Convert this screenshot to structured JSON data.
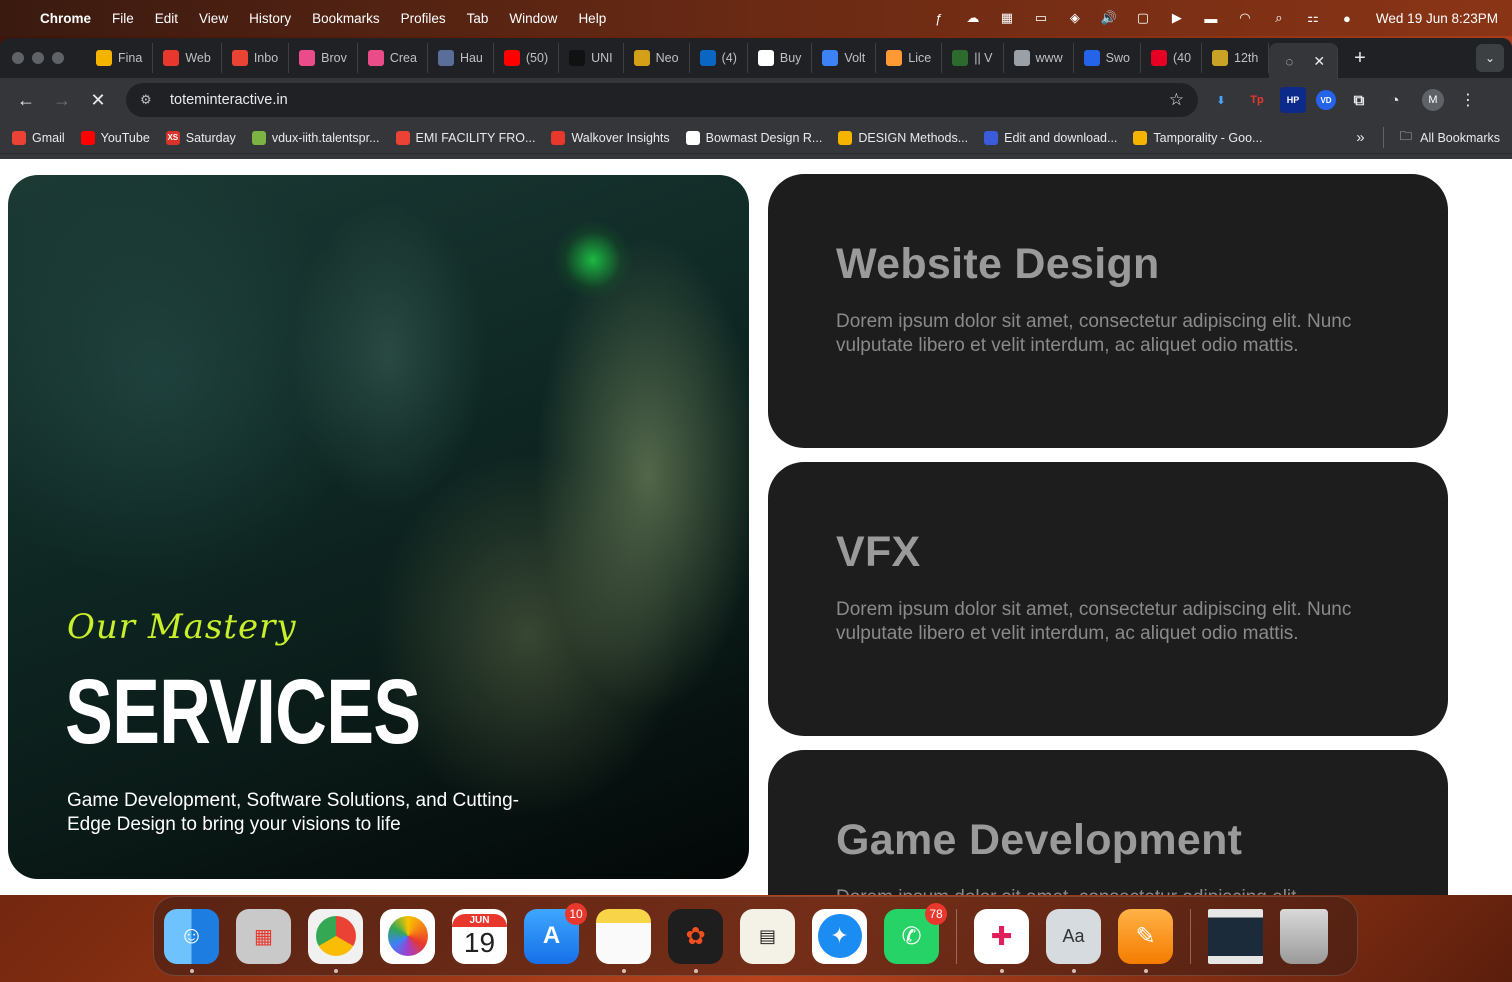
{
  "menubar": {
    "app_name": "Chrome",
    "items": [
      "File",
      "Edit",
      "View",
      "History",
      "Bookmarks",
      "Profiles",
      "Tab",
      "Window",
      "Help"
    ],
    "clock": "Wed 19 Jun  8:23PM"
  },
  "tabs": [
    {
      "label": "Fina",
      "icon": "google-drive-icon",
      "color": "#f4b400"
    },
    {
      "label": "Web",
      "icon": "webflow-icon",
      "color": "#e8382d"
    },
    {
      "label": "Inbo",
      "icon": "gmail-icon",
      "color": "#ea4335"
    },
    {
      "label": "Brov",
      "icon": "dribbble-icon",
      "color": "#ea4c89"
    },
    {
      "label": "Crea",
      "icon": "dribbble-icon",
      "color": "#ea4c89"
    },
    {
      "label": "Hau",
      "icon": "image-icon",
      "color": "#5a6e9a"
    },
    {
      "label": "(50)",
      "icon": "youtube-icon",
      "color": "#ff0000"
    },
    {
      "label": "UNI",
      "icon": "unstop-icon",
      "color": "#111111"
    },
    {
      "label": "Neo",
      "icon": "neo-icon",
      "color": "#d4a017"
    },
    {
      "label": "(4)",
      "icon": "linkedin-icon",
      "color": "#0a66c2"
    },
    {
      "label": "Buy",
      "icon": "amazon-icon",
      "color": "#ffffff"
    },
    {
      "label": "Volt",
      "icon": "volt-icon",
      "color": "#3b82f6"
    },
    {
      "label": "Lice",
      "icon": "india-flag-icon",
      "color": "#ff9933"
    },
    {
      "label": "|| V",
      "icon": "figure-icon",
      "color": "#2d6a2d"
    },
    {
      "label": "www",
      "icon": "globe-icon",
      "color": "#9aa0a6"
    },
    {
      "label": "Swo",
      "icon": "framer-icon",
      "color": "#2563eb"
    },
    {
      "label": "(40",
      "icon": "pinterest-icon",
      "color": "#e60023"
    },
    {
      "label": "12th",
      "icon": "award-icon",
      "color": "#c9a227"
    }
  ],
  "url": "toteminteractive.in",
  "bookmarks": [
    {
      "label": "Gmail",
      "icon": "gmail-icon",
      "color": "#ea4335"
    },
    {
      "label": "YouTube",
      "icon": "youtube-icon",
      "color": "#ff0000"
    },
    {
      "label": "Saturday",
      "icon": "xs-icon",
      "color": "#d9342b",
      "glyph": "XS"
    },
    {
      "label": "vdux-iith.talentspr...",
      "icon": "runner-icon",
      "color": "#7cb342"
    },
    {
      "label": "EMI FACILITY FRO...",
      "icon": "gmail-icon",
      "color": "#ea4335"
    },
    {
      "label": "Walkover Insights",
      "icon": "walkover-icon",
      "color": "#e8382d"
    },
    {
      "label": "Bowmast Design R...",
      "icon": "wordpress-icon",
      "color": "#ffffff"
    },
    {
      "label": "DESIGN Methods...",
      "icon": "slides-icon",
      "color": "#f4b400"
    },
    {
      "label": "Edit and download...",
      "icon": "hand-icon",
      "color": "#3b5bdb"
    },
    {
      "label": "Tamporality - Goo...",
      "icon": "slides-icon",
      "color": "#f4b400"
    }
  ],
  "all_bookmarks": "All Bookmarks",
  "hero": {
    "eyebrow": "Our Mastery",
    "title": "SERVICES",
    "description": "Game Development, Software Solutions, and Cutting-Edge Design to bring your visions to life"
  },
  "services": [
    {
      "title": "Website Design",
      "body": "Dorem ipsum dolor sit amet, consectetur adipiscing elit. Nunc vulputate libero et velit interdum, ac aliquet odio mattis."
    },
    {
      "title": "VFX",
      "body": "Dorem ipsum dolor sit amet, consectetur adipiscing elit. Nunc vulputate libero et velit interdum, ac aliquet odio mattis."
    },
    {
      "title": "Game Development",
      "body": "Dorem ipsum dolor sit amet, consectetur adipiscing elit."
    }
  ],
  "dock": {
    "calendar_month": "JUN",
    "calendar_day": "19",
    "appstore_badge": "10",
    "whatsapp_badge": "78"
  }
}
